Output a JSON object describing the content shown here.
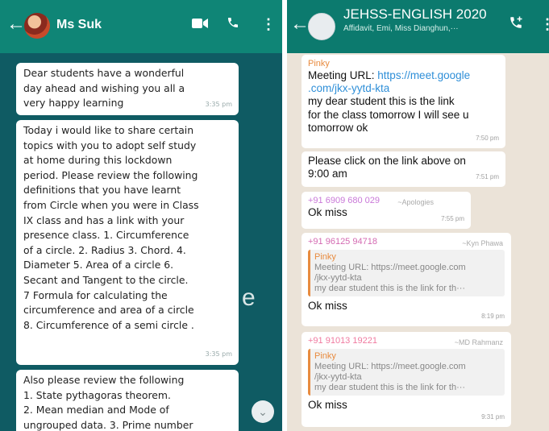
{
  "left": {
    "header": {
      "contact_name": "Ms Suk"
    },
    "messages": [
      {
        "text": "Dear students have a wonderful\nday ahead and wishing you all a\nvery happy learning",
        "time": "3:35 pm"
      },
      {
        "text": "Today i would like to share certain\ntopics with you to adopt self study\nat home during this lockdown\nperiod. Please review the following\ndefinitions that you have learnt\nfrom Circle when you were in Class\nIX class and has a link with your\npresence class. 1. Circumference\nof a circle. 2. Radius 3. Chord. 4.\nDiameter 5. Area of a circle 6.\nSecant and Tangent to the circle.\n7 Formula for calculating the\ncircumference and area of a circle\n8. Circumference of a semi circle .",
        "time": "3:35 pm"
      },
      {
        "text": "Also please review the following\n1. State pythagoras theorem.\n2. Mean median and Mode of\nungrouped data. 3. Prime number"
      }
    ],
    "wallpaper_letter": "e"
  },
  "right": {
    "header": {
      "group_name": "JEHSS-ENGLISH 2020",
      "members": "Affidavit, Emi, Miss Dianghun,···"
    },
    "msg1": {
      "sender": "Pinky",
      "label": "Meeting URL: ",
      "link": "https://meet.google\n.com/jkx-yytd-kta",
      "text": "my dear student this is the link\nfor the class tomorrow I will see u\ntomorrow ok",
      "time": "7:50 pm"
    },
    "msg2": {
      "text": "Please click on the link above on\n9:00 am",
      "time": "7:51 pm"
    },
    "msg3": {
      "sender": "+91 6909 680 029",
      "tag": "~Apologies",
      "text": "Ok miss",
      "time": "7:55 pm"
    },
    "msg4": {
      "sender": "+91 96125 94718",
      "tag": "~Kyn Phawa",
      "quote": {
        "sender": "Pinky",
        "lines": [
          "Meeting URL: https://meet.google.com",
          "/jkx-yytd-kta",
          "my dear student this is the link for th···"
        ]
      },
      "text": "Ok miss",
      "time": "8:19 pm"
    },
    "msg5": {
      "sender": "+91 91013 19221",
      "tag": "~MD Rahmanz",
      "quote": {
        "sender": "Pinky",
        "lines": [
          "Meeting URL: https://meet.google.com",
          "/jkx-yytd-kta",
          "my dear student this is the link for th···"
        ]
      },
      "text": "Ok miss",
      "time": "9:31 pm"
    }
  },
  "colors": {
    "header_green": "#0c7a6e",
    "left_wallpaper": "#0f5b63",
    "right_wallpaper": "#ebe3d8",
    "link_blue": "#2f8fd8",
    "quote_orange": "#e88b3f",
    "sender_pink": "#d46ab2"
  }
}
